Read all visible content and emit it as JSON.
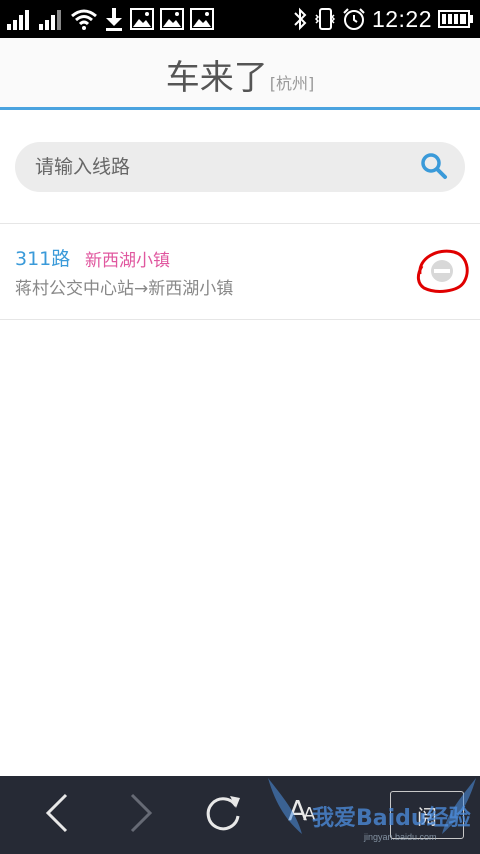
{
  "status_bar": {
    "time": "12:22",
    "icons": [
      "signal-icon",
      "signal-icon",
      "wifi-icon",
      "download-icon",
      "image-icon",
      "image-icon",
      "image-icon",
      "bluetooth-icon",
      "vibrate-icon",
      "alarm-icon",
      "battery-icon"
    ]
  },
  "header": {
    "title": "车来了",
    "city": "[杭州]"
  },
  "search": {
    "placeholder": "请输入线路",
    "icon": "search-icon"
  },
  "routes": [
    {
      "number": "311路",
      "destination": "新西湖小镇",
      "path": "蒋村公交中心站→新西湖小镇",
      "toggle_icon": "favorite-toggle-icon"
    }
  ],
  "bottom_bar": {
    "back_icon": "chevron-left-icon",
    "forward_icon": "chevron-right-icon",
    "refresh_icon": "refresh-icon",
    "font_large": "A",
    "font_small": "A",
    "read_label": "阅",
    "watermark": "我爱Baidu经验",
    "watermark_sub": "jingyan.baidu.com"
  },
  "colors": {
    "accent": "#4aa3df",
    "route_number": "#3a9ad9",
    "route_destination": "#e0579f",
    "annotation": "#e00000"
  }
}
